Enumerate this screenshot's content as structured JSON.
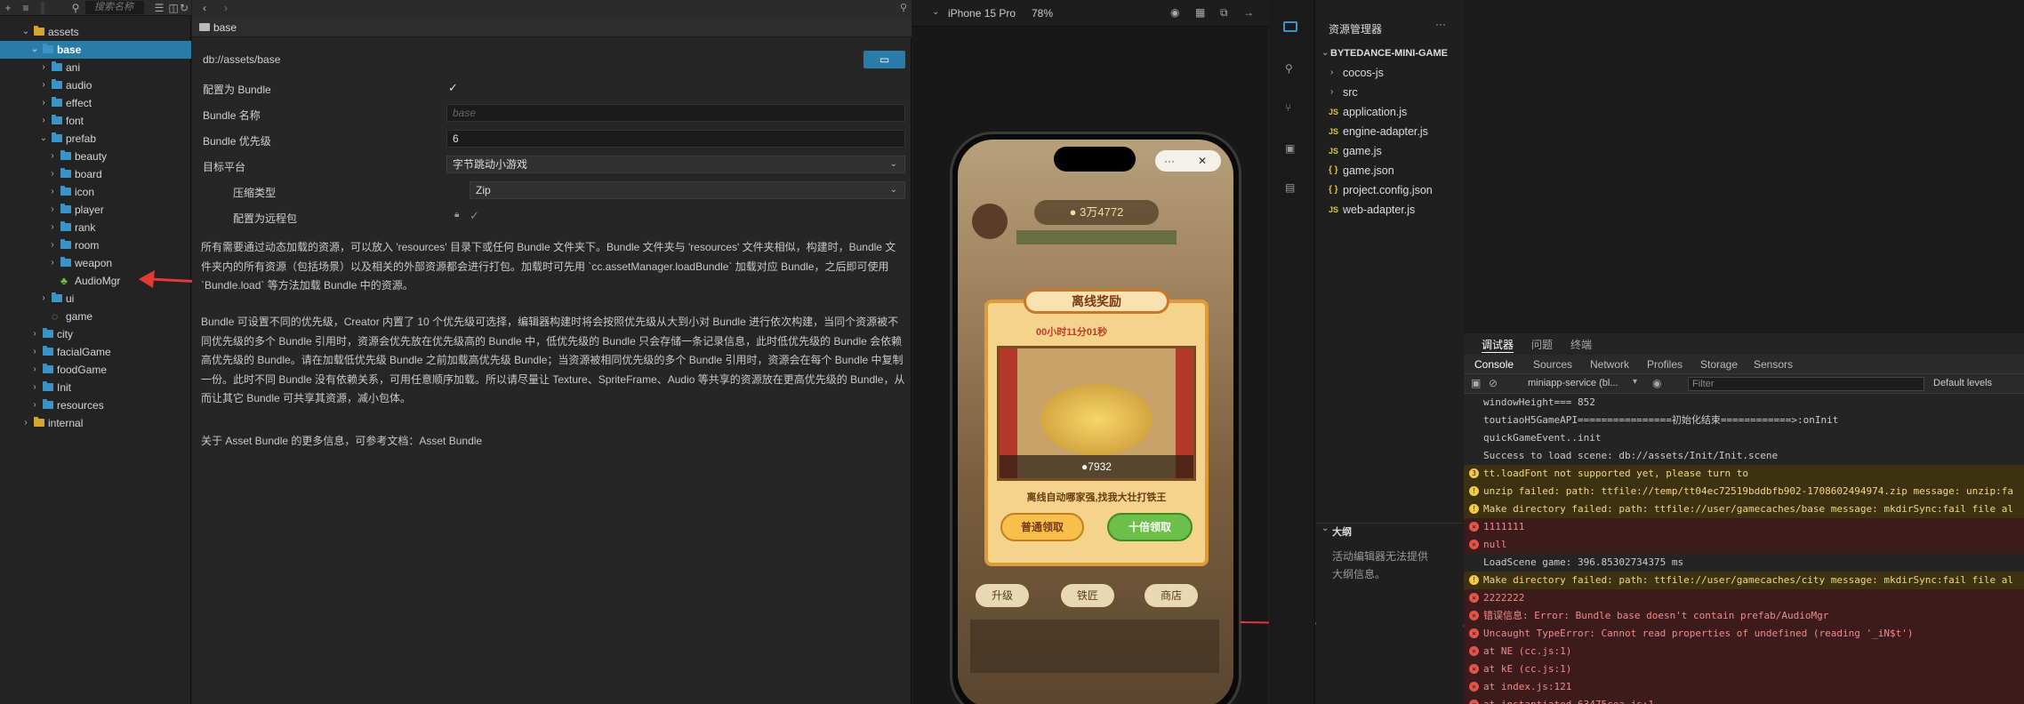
{
  "tree": {
    "search_placeholder": "搜索名称",
    "toolbar_icons": [
      "add-icon",
      "sort-icon",
      "search-icon",
      "collapse-icon",
      "locate-icon",
      "refresh-icon"
    ],
    "items": [
      {
        "label": "assets",
        "level": 0,
        "open": true,
        "icon": "database-icon"
      },
      {
        "label": "base",
        "level": 1,
        "open": true,
        "icon": "folder-icon",
        "selected": true
      },
      {
        "label": "ani",
        "level": 2,
        "icon": "folder-icon"
      },
      {
        "label": "audio",
        "level": 2,
        "icon": "folder-icon"
      },
      {
        "label": "effect",
        "level": 2,
        "icon": "folder-icon"
      },
      {
        "label": "font",
        "level": 2,
        "icon": "folder-icon"
      },
      {
        "label": "prefab",
        "level": 2,
        "open": true,
        "icon": "folder-icon"
      },
      {
        "label": "beauty",
        "level": 3,
        "icon": "folder-icon"
      },
      {
        "label": "board",
        "level": 3,
        "icon": "folder-icon"
      },
      {
        "label": "icon",
        "level": 3,
        "icon": "folder-icon"
      },
      {
        "label": "player",
        "level": 3,
        "icon": "folder-icon"
      },
      {
        "label": "rank",
        "level": 3,
        "icon": "folder-icon"
      },
      {
        "label": "room",
        "level": 3,
        "icon": "folder-icon"
      },
      {
        "label": "weapon",
        "level": 3,
        "icon": "folder-icon"
      },
      {
        "label": "AudioMgr",
        "level": 3,
        "icon": "prefab-icon",
        "leaf": true
      },
      {
        "label": "ui",
        "level": 2,
        "icon": "folder-icon"
      },
      {
        "label": "game",
        "level": 2,
        "icon": "scene-icon",
        "leaf": true
      },
      {
        "label": "city",
        "level": 1,
        "icon": "folder-icon"
      },
      {
        "label": "facialGame",
        "level": 1,
        "icon": "folder-icon"
      },
      {
        "label": "foodGame",
        "level": 1,
        "icon": "folder-icon"
      },
      {
        "label": "Init",
        "level": 1,
        "icon": "folder-icon"
      },
      {
        "label": "resources",
        "level": 1,
        "icon": "folder-icon"
      },
      {
        "label": "internal",
        "level": 0,
        "icon": "database-icon"
      }
    ]
  },
  "inspector": {
    "title": "base",
    "path": "db://assets/base",
    "config_bundle_label": "配置为 Bundle",
    "bundle_name_label": "Bundle 名称",
    "bundle_name_placeholder": "base",
    "bundle_priority_label": "Bundle 优先级",
    "bundle_priority_value": "6",
    "target_platform_label": "目标平台",
    "target_platform_value": "字节跳动小游戏",
    "compression_label": "压缩类型",
    "compression_value": "Zip",
    "remote_label": "配置为远程包",
    "desc1_line1": "所有需要通过动态加载的资源，可以放入 'resources' 目录下或任何 Bundle 文件夹下。Bundle 文件夹与 'resources' 文件夹相似，构建时，Bundle 文",
    "desc1_line2": "件夹内的所有资源（包括场景）以及相关的外部资源都会进行打包。加载时可先用 `cc.assetManager.loadBundle` 加载对应 Bundle，之后即可使用",
    "desc1_line3": "`Bundle.load` 等方法加载 Bundle 中的资源。",
    "desc2_line1": "Bundle 可设置不同的优先级，Creator 内置了 10 个优先级可选择，编辑器构建时将会按照优先级从大到小对 Bundle 进行依次构建，当同个资源被不",
    "desc2_line2": "同优先级的多个 Bundle 引用时，资源会优先放在优先级高的 Bundle 中，低优先级的 Bundle 只会存储一条记录信息，此时低优先级的 Bundle 会依赖",
    "desc2_line3": "高优先级的 Bundle。请在加载低优先级 Bundle 之前加载高优先级 Bundle；当资源被相同优先级的多个 Bundle 引用时，资源会在每个 Bundle 中复制",
    "desc2_line4": "一份。此时不同 Bundle 没有依赖关系，可用任意顺序加载。所以请尽量让 Texture、SpriteFrame、Audio 等共享的资源放在更高优先级的 Bundle，从",
    "desc2_line5": "而让其它 Bundle 可共享其资源，减小包体。",
    "desc3": "关于 Asset Bundle 的更多信息，可参考文档：Asset Bundle"
  },
  "preview": {
    "device": "iPhone 15 Pro",
    "zoom": "78%",
    "game": {
      "currency": "3万4772",
      "popup_title": "离线奖励",
      "offline_time": "00小时11分01秒",
      "reward_amount": "7932",
      "subtitle": "离线自动哪家强,找我大壮打铁王",
      "btn_normal": "普通领取",
      "btn_ten": "十倍领取",
      "menu_btn": "···",
      "close_btn": "✕",
      "bottom_buttons": [
        "升级",
        "铁匠",
        "商店"
      ]
    }
  },
  "explorer": {
    "title": "资源管理器",
    "project": "BYTEDANCE-MINI-GAME",
    "items": [
      {
        "label": "cocos-js",
        "type": "folder"
      },
      {
        "label": "src",
        "type": "folder"
      },
      {
        "label": "application.js",
        "type": "js"
      },
      {
        "label": "engine-adapter.js",
        "type": "js"
      },
      {
        "label": "game.js",
        "type": "js"
      },
      {
        "label": "game.json",
        "type": "json"
      },
      {
        "label": "project.config.json",
        "type": "json"
      },
      {
        "label": "web-adapter.js",
        "type": "js"
      }
    ],
    "outline_title": "大纲",
    "outline_text1": "活动编辑器无法提供",
    "outline_text2": "大纲信息。"
  },
  "devtools": {
    "top_tabs": [
      "调试器",
      "问题",
      "终端"
    ],
    "panel_tabs": [
      "Console",
      "Sources",
      "Network",
      "Profiles",
      "Storage",
      "Sensors"
    ],
    "context": "miniapp-service (bl...",
    "filter_placeholder": "Filter",
    "levels": "Default levels",
    "logs": [
      {
        "type": "log",
        "text": "windowHeight=== 852"
      },
      {
        "type": "log",
        "text": "toutiaoH5GameAPI================初始化结束============>:onInit"
      },
      {
        "type": "log",
        "text": "quickGameEvent..init"
      },
      {
        "type": "log",
        "text": "Success to load scene: db://assets/Init/Init.scene"
      },
      {
        "type": "warn",
        "count": "3",
        "text": "tt.loadFont not supported yet, please turn to"
      },
      {
        "type": "warn",
        "text": "unzip failed: path: ttfile://temp/tt04ec72519bddbfb902-1708602494974.zip message: unzip:fa"
      },
      {
        "type": "warn",
        "text": "Make directory failed: path: ttfile://user/gamecaches/base message: mkdirSync:fail file al"
      },
      {
        "type": "err",
        "text": "1111111"
      },
      {
        "type": "err",
        "text": "null"
      },
      {
        "type": "log",
        "text": "LoadScene game: 396.85302734375 ms"
      },
      {
        "type": "warn",
        "text": "Make directory failed: path: ttfile://user/gamecaches/city message: mkdirSync:fail file al"
      },
      {
        "type": "err",
        "text": "2222222"
      },
      {
        "type": "err",
        "text": "错误信息: Error: Bundle base doesn't contain prefab/AudioMgr"
      },
      {
        "type": "err",
        "text": "Uncaught TypeError: Cannot read properties of undefined (reading '_iN$t')"
      },
      {
        "type": "err",
        "text": "    at NE (cc.js:1)"
      },
      {
        "type": "err",
        "text": "    at kE (cc.js:1)"
      },
      {
        "type": "err",
        "text": "    at index.js:121"
      },
      {
        "type": "err",
        "text": "    at instantiated-63475cea.js:1"
      }
    ]
  },
  "colors": {
    "selection": "#2a7ca8",
    "annotation_arrow": "#e53935",
    "warn_bg": "#3c3212",
    "error_bg": "#3b1b1b"
  }
}
